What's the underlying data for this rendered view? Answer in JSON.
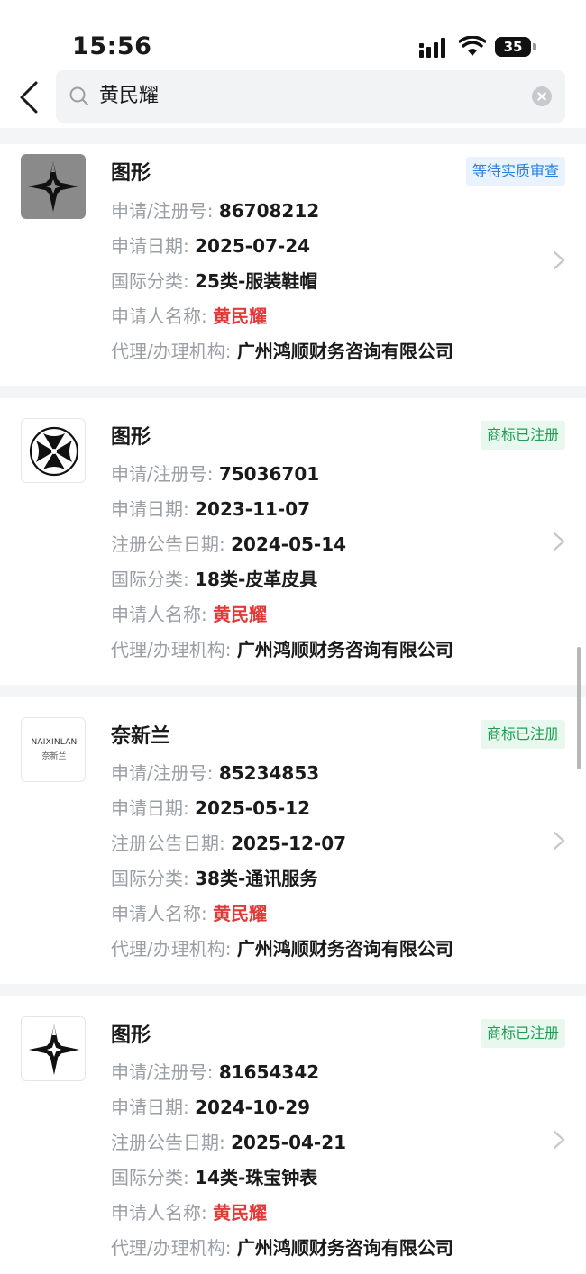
{
  "status_bar": {
    "time": "15:56",
    "battery": "35"
  },
  "search": {
    "query": "黄民耀"
  },
  "results": [
    {
      "logo": "four-point-star-logo-gray",
      "title": "图形",
      "badge": "等待实质审查",
      "badge_color": "#2a7fe0",
      "fields": [
        {
          "label": "申请/注册号:",
          "value": "86708212"
        },
        {
          "label": "申请日期:",
          "value": "2025-07-24"
        },
        {
          "label": "国际分类:",
          "value": "25类-服装鞋帽"
        },
        {
          "label": "申请人名称:",
          "value": "黄民耀",
          "highlight": true
        },
        {
          "label": "代理/办理机构:",
          "value": "广州鸿顺财务咨询有限公司"
        }
      ]
    },
    {
      "logo": "circle-four-petal-logo",
      "title": "图形",
      "badge": "商标已注册",
      "badge_color": "#1f9d55",
      "fields": [
        {
          "label": "申请/注册号:",
          "value": "75036701"
        },
        {
          "label": "申请日期:",
          "value": "2023-11-07"
        },
        {
          "label": "注册公告日期:",
          "value": "2024-05-14"
        },
        {
          "label": "国际分类:",
          "value": "18类-皮革皮具"
        },
        {
          "label": "申请人名称:",
          "value": "黄民耀",
          "highlight": true
        },
        {
          "label": "代理/办理机构:",
          "value": "广州鸿顺财务咨询有限公司"
        }
      ]
    },
    {
      "logo": "naixinlan-text-logo",
      "logo_text": [
        "NAIXINLAN",
        "奈新兰"
      ],
      "title": "奈新兰",
      "badge": "商标已注册",
      "badge_color": "#1f9d55",
      "fields": [
        {
          "label": "申请/注册号:",
          "value": "85234853"
        },
        {
          "label": "申请日期:",
          "value": "2025-05-12"
        },
        {
          "label": "注册公告日期:",
          "value": "2025-12-07"
        },
        {
          "label": "国际分类:",
          "value": "38类-通讯服务"
        },
        {
          "label": "申请人名称:",
          "value": "黄民耀",
          "highlight": true
        },
        {
          "label": "代理/办理机构:",
          "value": "广州鸿顺财务咨询有限公司"
        }
      ]
    },
    {
      "logo": "four-point-star-logo",
      "title": "图形",
      "badge": "商标已注册",
      "badge_color": "#1f9d55",
      "fields": [
        {
          "label": "申请/注册号:",
          "value": "81654342"
        },
        {
          "label": "申请日期:",
          "value": "2024-10-29"
        },
        {
          "label": "注册公告日期:",
          "value": "2025-04-21"
        },
        {
          "label": "国际分类:",
          "value": "14类-珠宝钟表"
        },
        {
          "label": "申请人名称:",
          "value": "黄民耀",
          "highlight": true
        },
        {
          "label": "代理/办理机构:",
          "value": "广州鸿顺财务咨询有限公司"
        }
      ]
    }
  ]
}
